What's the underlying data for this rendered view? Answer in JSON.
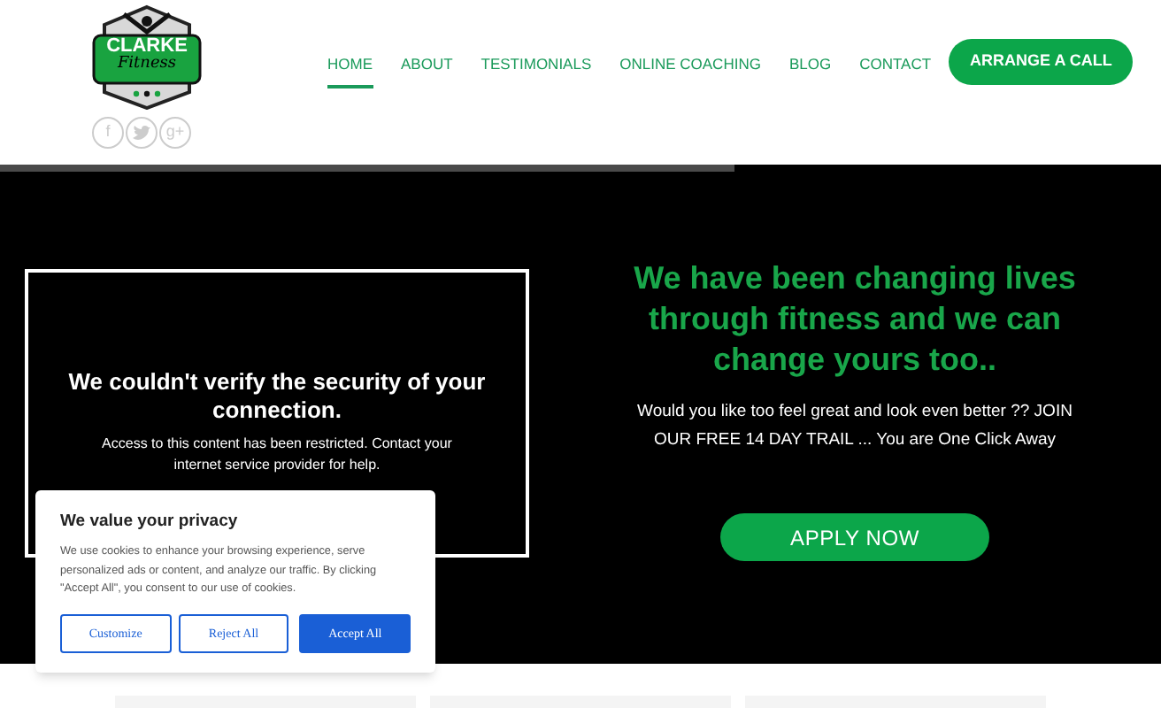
{
  "logo": {
    "name": "CLARKE",
    "tagline": "Fitness"
  },
  "social": [
    {
      "kind": "text",
      "glyph": "f"
    },
    {
      "kind": "bird"
    },
    {
      "kind": "text",
      "glyph": "g+"
    }
  ],
  "nav": [
    {
      "label": "HOME",
      "selected": true
    },
    {
      "label": "ABOUT",
      "selected": false
    },
    {
      "label": "TESTIMONIALS",
      "selected": false
    },
    {
      "label": "ONLINE COACHING",
      "selected": false
    },
    {
      "label": "BLOG",
      "selected": false
    },
    {
      "label": "CONTACT",
      "selected": false
    }
  ],
  "cta_button": "ARRANGE A CALL",
  "video_error": {
    "title": "We couldn't verify the security of your connection.",
    "message": "Access to this content has been restricted. Contact your internet service provider for help."
  },
  "hero": {
    "heading": "We have been changing lives through fitness and we can change yours too..",
    "text": "Would you like too feel great and look even better ?? JOIN OUR FREE 14 DAY TRAIL ... You are One Click Away",
    "button": "APPLY NOW"
  },
  "cookie_banner": {
    "title": "We value your privacy",
    "text": "We use cookies to enhance your browsing experience, serve personalized ads or content, and analyze our traffic. By clicking \"Accept All\", you consent to our use of cookies.",
    "buttons": [
      {
        "label": "Customize",
        "kind": "outline"
      },
      {
        "label": "Reject All",
        "kind": "outline"
      },
      {
        "label": "Accept All",
        "kind": "primary"
      }
    ]
  }
}
